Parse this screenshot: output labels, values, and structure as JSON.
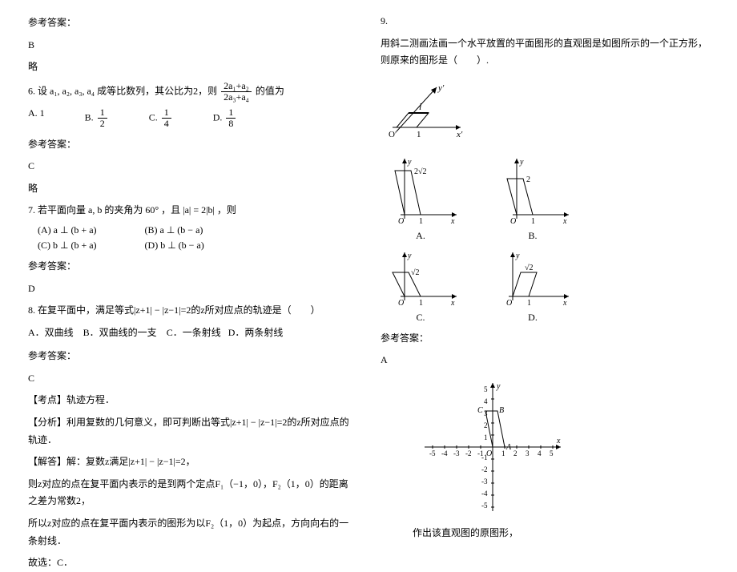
{
  "left": {
    "ans_label": "参考答案：",
    "q5_ans": "B",
    "q5_comment": "略",
    "q6_text_a": "6. 设",
    "q6_vars": "a₁, a₂, a₃, a₄",
    "q6_text_b": "成等比数列，其公比为2，则",
    "q6_num": "2a₁+a₂",
    "q6_den": "2a₃+a₄",
    "q6_text_c": "的值为",
    "q6_optA": "A.  1",
    "q6_optB": "B.",
    "q6_optC": "C.",
    "q6_optD": "D.",
    "q6_B_num": "1",
    "q6_B_den": "2",
    "q6_C_num": "1",
    "q6_C_den": "4",
    "q6_D_num": "1",
    "q6_D_den": "8",
    "q6_ans": "C",
    "q6_comment": "略",
    "q7_text_a": "7. 若平面向量",
    "q7_vec": "a, b",
    "q7_text_b": "的夹角为",
    "q7_angle": "60°",
    "q7_text_c": "，且",
    "q7_cond": "|a| = 2|b|",
    "q7_text_d": "，则",
    "q7_A": "(A) a ⊥ (b + a)",
    "q7_B": "(B) a ⊥ (b − a)",
    "q7_C": "(C) b ⊥ (b + a)",
    "q7_D": "(D) b ⊥ (b − a)",
    "q7_ans": "D",
    "q8_text": "8. 在复平面中，满足等式|z+1| − |z−1|=2的z所对应点的轨迹是（　　）",
    "q8_A": "A．双曲线",
    "q8_B": "B．双曲线的一支",
    "q8_C": "C．一条射线",
    "q8_D": "D．两条射线",
    "q8_ans": "C",
    "q8_kd_label": "【考点】",
    "q8_kd": "轨迹方程．",
    "q8_fx_label": "【分析】",
    "q8_fx": "利用复数的几何意义，即可判断出等式|z+1| − |z−1|=2的z所对应点的轨迹．",
    "q8_jd_label": "【解答】",
    "q8_jd1": "解：复数z满足|z+1| − |z−1|=2，",
    "q8_jd2": "则z对应的点在复平面内表示的是到两个定点F₁（−1，0），F₂（1，0）的距离之差为常数2，",
    "q8_jd3": "所以z对应的点在复平面内表示的图形为以F₂（1，0）为起点，方向向右的一条射线．",
    "q8_jd4": "故选：C．"
  },
  "right": {
    "q9_label": "9.",
    "q9_text": "用斜二测画法画一个水平放置的平面图形的直观图是如图所示的一个正方形，则原来的图形是（　　）.",
    "y_prime": "y′",
    "x_prime": "x′",
    "O_prime": "O′",
    "one": "1",
    "optA": "A.",
    "optB": "B.",
    "optC": "C.",
    "optD": "D.",
    "val_2root2": "2√2",
    "val_2": "2",
    "val_root2": "√2",
    "val_root2_2": "√2",
    "q9_ans": "A",
    "caption": "作出该直观图的原图形，",
    "ans_label": "参考答案："
  },
  "chart_data": {
    "type": "other",
    "main_diagram": {
      "type": "oblique-square",
      "O": "O′",
      "x_unit": 1,
      "y_axis": "y′",
      "x_axis": "x′"
    },
    "options": [
      {
        "label": "A",
        "shape": "parallelogram",
        "height": "2√2",
        "base": 1
      },
      {
        "label": "B",
        "shape": "parallelogram",
        "height": 2,
        "base": 1
      },
      {
        "label": "C",
        "shape": "parallelogram",
        "height": "√2",
        "base": 1
      },
      {
        "label": "D",
        "shape": "parallelogram",
        "height": "√2",
        "base": 1,
        "lean": "right"
      }
    ],
    "coord_plot": {
      "x_range": [
        -5,
        5
      ],
      "y_range": [
        -5,
        5
      ],
      "points": {
        "A": [
          1,
          0
        ],
        "B": [
          0.4,
          3
        ],
        "C": [
          -0.6,
          3
        ]
      },
      "x_ticks": [
        -5,
        -4,
        -3,
        -2,
        -1,
        1,
        2,
        3,
        4,
        5
      ],
      "y_ticks": [
        -5,
        -4,
        -3,
        -2,
        -1,
        1,
        2,
        3,
        4,
        5
      ]
    }
  }
}
